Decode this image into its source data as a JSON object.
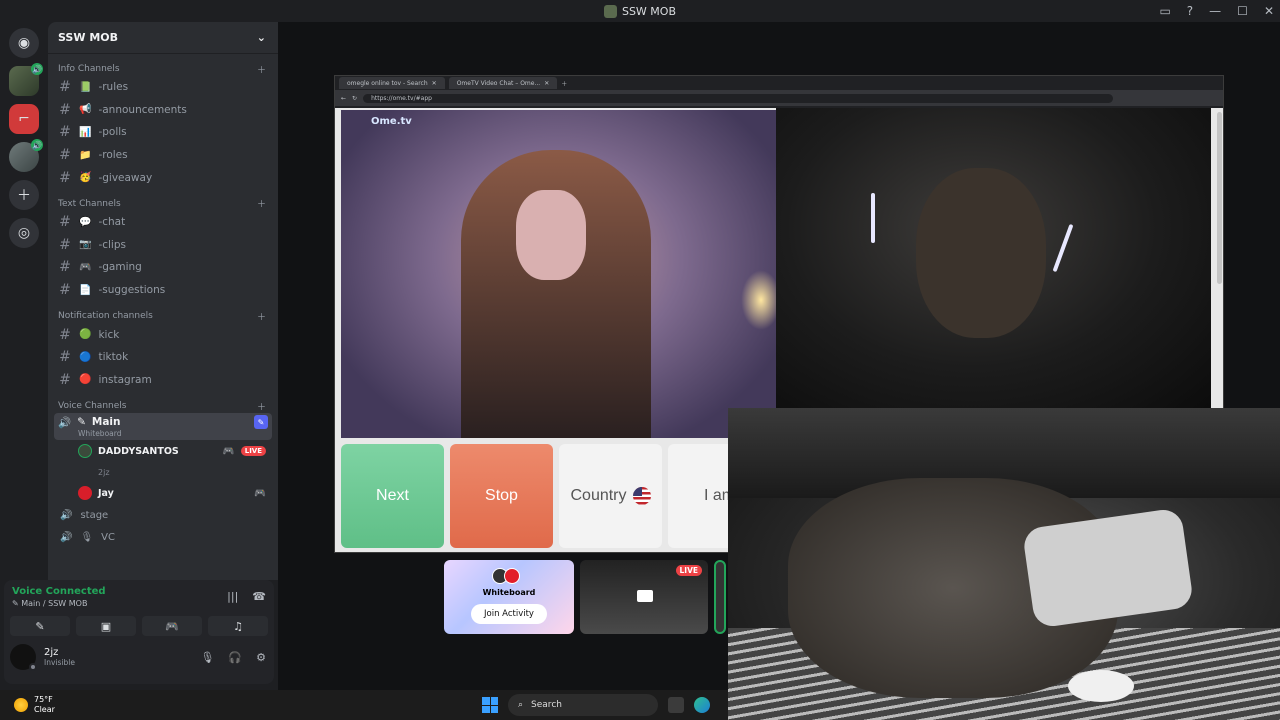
{
  "window": {
    "title": "SSW MOB"
  },
  "server": {
    "name": "SSW MOB"
  },
  "categories": [
    {
      "name": "Info Channels",
      "channels": [
        {
          "emoji": "📗",
          "name": "-rules"
        },
        {
          "emoji": "📢",
          "name": "-announcements"
        },
        {
          "emoji": "📊",
          "name": "-polls"
        },
        {
          "emoji": "📁",
          "name": "-roles"
        },
        {
          "emoji": "🥳",
          "name": "-giveaway"
        }
      ]
    },
    {
      "name": "Text Channels",
      "channels": [
        {
          "emoji": "💬",
          "name": "-chat"
        },
        {
          "emoji": "📷",
          "name": "-clips"
        },
        {
          "emoji": "🎮",
          "name": "-gaming"
        },
        {
          "emoji": "📄",
          "name": "-suggestions"
        }
      ]
    },
    {
      "name": "Notification channels",
      "channels": [
        {
          "emoji": "🟢",
          "name": "kick"
        },
        {
          "emoji": "🔵",
          "name": "tiktok"
        },
        {
          "emoji": "🔴",
          "name": "instagram"
        }
      ]
    }
  ],
  "voice": {
    "category": "Voice Channels",
    "main": {
      "name": "Main",
      "activity": "Whiteboard"
    },
    "members": [
      {
        "name": "DADDYSANTOS",
        "badge": "LIVE",
        "status": "2jz"
      },
      {
        "name": "Jay"
      }
    ],
    "others": [
      "stage",
      "VC"
    ]
  },
  "voice_panel": {
    "status": "Voice Connected",
    "location": "Main / SSW MOB"
  },
  "user": {
    "name": "2jz",
    "status": "Invisible"
  },
  "browser": {
    "tabs": [
      "omegle online tov - Search",
      "OmeTV Video Chat – Ome..."
    ],
    "url": "https://ome.tv/#app",
    "logo": "Ome.tv"
  },
  "ometv_controls": {
    "next": "Next",
    "stop": "Stop",
    "country": "Country",
    "iam": "I am"
  },
  "activities": {
    "whiteboard_title": "Whiteboard",
    "join_label": "Join Activity",
    "stream_badge": "LIVE"
  },
  "taskbar": {
    "temp": "75°F",
    "condition": "Clear",
    "search_label": "Search"
  },
  "colors": {
    "accent_green": "#23a55a",
    "live_red": "#ed4245",
    "next_green": "#6fca95",
    "stop_red": "#e57659"
  }
}
